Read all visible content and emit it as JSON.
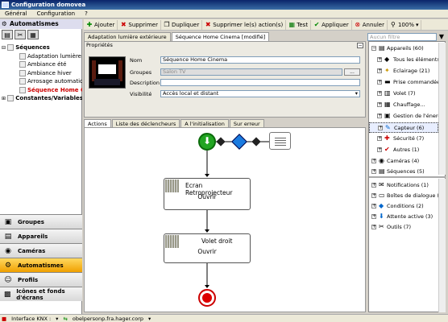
{
  "window": {
    "title": "Configuration domovea"
  },
  "menu": [
    "Général",
    "Configuration",
    "?"
  ],
  "toolbar": {
    "add": "Ajouter",
    "delete": "Supprimer",
    "duplicate": "Dupliquer",
    "delete_actions": "Supprimer le(s) action(s)",
    "test": "Test",
    "apply": "Appliquer",
    "cancel": "Annuler",
    "zoom": "100%"
  },
  "search": {
    "placeholder": "Aucun filtre"
  },
  "left": {
    "header": "Automatismes",
    "tree": [
      {
        "label": "Séquences",
        "level": 0,
        "bold": true
      },
      {
        "label": "Adaptation lumière extérie",
        "level": 1
      },
      {
        "label": "Ambiance été",
        "level": 1
      },
      {
        "label": "Ambiance hiver",
        "level": 1
      },
      {
        "label": "Arrosage automatique",
        "level": 1
      },
      {
        "label": "Séquence Home Ci",
        "level": 1,
        "selected": true
      },
      {
        "label": "Constantes/Variables",
        "level": 0,
        "bold": true
      }
    ],
    "nav": [
      "Groupes",
      "Appareils",
      "Caméras",
      "Automatismes",
      "Profils",
      "Icônes et fonds d'écrans"
    ],
    "nav_active": "Automatismes"
  },
  "tabs_top": [
    "Adaptation lumière extérieure",
    "Séquence Home Cinema [modifié]"
  ],
  "properties": {
    "title": "Propriétés",
    "name_label": "Nom",
    "name_value": "Séquence Home Cinema",
    "groups_label": "Groupes",
    "groups_value": "Salon TV",
    "groups_btn": "...",
    "desc_label": "Description",
    "desc_value": "",
    "visibility_label": "Visibilité",
    "visibility_value": "Accès local et distant"
  },
  "tabs_bottom": [
    "Actions",
    "Liste des déclencheurs",
    "A l'initialisation",
    "Sur erreur"
  ],
  "diagram": {
    "nodes": [
      {
        "title": "Ecran Retroprojecteur",
        "action": "Ouvrir"
      },
      {
        "title": "Volet droit",
        "action": "Ouvrir"
      }
    ]
  },
  "right": {
    "top": [
      {
        "label": "Appareils (60)",
        "level": 0
      },
      {
        "label": "Tous les éléments...",
        "level": 1
      },
      {
        "label": "Eclairage (21)",
        "level": 1
      },
      {
        "label": "Prise commandée...",
        "level": 1
      },
      {
        "label": "Volet (7)",
        "level": 1
      },
      {
        "label": "Chauffage...",
        "level": 1
      },
      {
        "label": "Gestion de l'énergie...",
        "level": 1
      },
      {
        "label": "Capteur (6)",
        "level": 1,
        "selected": true
      },
      {
        "label": "Sécurité (7)",
        "level": 1
      },
      {
        "label": "Autres (1)",
        "level": 1
      },
      {
        "label": "Caméras (4)",
        "level": 0
      },
      {
        "label": "Séquences (5)",
        "level": 0
      }
    ],
    "bottom": [
      {
        "label": "Notifications (1)"
      },
      {
        "label": "Boîtes de dialogue (3)"
      },
      {
        "label": "Conditions (2)"
      },
      {
        "label": "Attente active (3)"
      },
      {
        "label": "Outils (7)"
      }
    ]
  },
  "status": {
    "interface": "Interface KNX :",
    "host": "obelpersonp.fra.hager.corp"
  }
}
